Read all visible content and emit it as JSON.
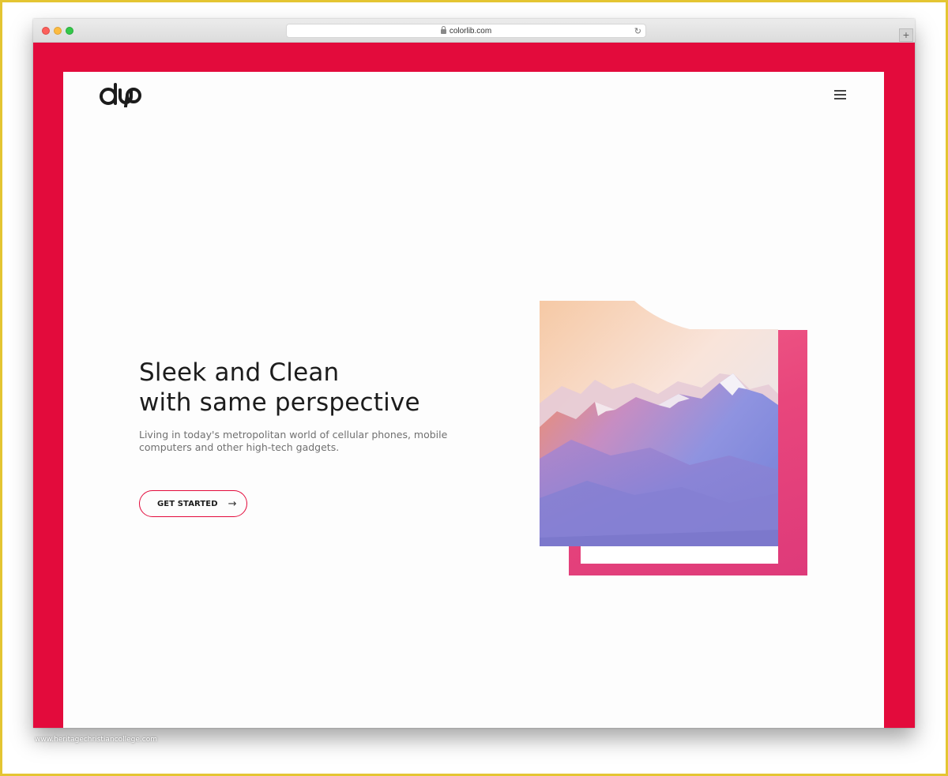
{
  "browser": {
    "url": "colorlib.com"
  },
  "header": {
    "logo_text": "dup"
  },
  "hero": {
    "title_line1": "Sleek and Clean",
    "title_line2": "with same perspective",
    "text_line1": "Living in today's metropolitan world of cellular phones, mobile",
    "text_line2": "computers and other high-tech gadgets.",
    "cta_label": "GET STARTED"
  },
  "watermark": "www.heritagechristiancollege.com",
  "icons": {
    "menu": "hamburger-menu-icon",
    "cta_arrow": "arrow-right-icon",
    "lock": "lock-icon",
    "reload": "reload-icon",
    "new_tab": "plus-icon"
  },
  "colors": {
    "accent": "#e30b3c",
    "frame_pink": "#e8467c",
    "page_background": "#fdfdfd",
    "heading": "#1c1c1c",
    "body_text": "#707070"
  }
}
